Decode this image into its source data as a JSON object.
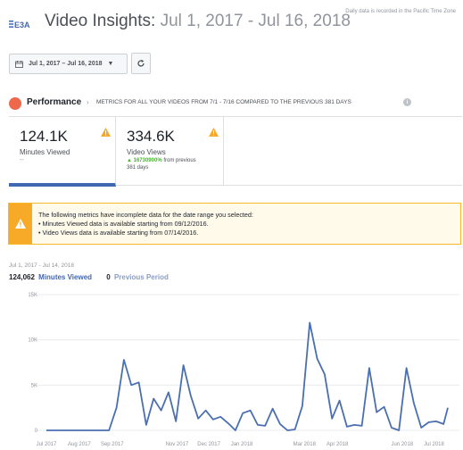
{
  "header": {
    "timezone_note": "Daily data is recorded in the Pacific Time Zone",
    "logo_text": "E3A",
    "title": "Video Insights:",
    "title_range": "Jul 1, 2017 - Jul 16, 2018"
  },
  "toolbar": {
    "date_range_label": "Jul 1, 2017 – Jul 16, 2018"
  },
  "performance": {
    "title": "Performance",
    "description": "METRICS FOR ALL YOUR VIDEOS FROM 7/1 - 7/16 COMPARED TO THE PREVIOUS 381 DAYS"
  },
  "metrics": [
    {
      "value": "124.1K",
      "label": "Minutes Viewed",
      "sub": "--"
    },
    {
      "value": "334.6K",
      "label": "Video Views",
      "change": "16730900%",
      "change_suffix": "from previous",
      "change_days": "381 days"
    }
  ],
  "alert": {
    "line1": "The following metrics have incomplete data for the date range you selected:",
    "line2": "• Minutes Viewed data is available starting from 09/12/2016.",
    "line3": "• Video Views data is available starting from 07/14/2016."
  },
  "chart_header": {
    "range": "Jul 1, 2017 - Jul 14, 2018",
    "series1_value": "124,062",
    "series1_name": "Minutes Viewed",
    "series2_value": "0",
    "series2_name": "Previous Period"
  },
  "colors": {
    "accent": "#4267b2",
    "line": "#4a6fb0",
    "warning": "#f7a928"
  },
  "chart_data": {
    "type": "line",
    "xlabels": [
      "Jul 2017",
      "Aug 2017",
      "Sep 2017",
      "Nov 2017",
      "Dec 2017",
      "Jan 2018",
      "Mar 2018",
      "Apr 2018",
      "Jun 2018",
      "Jul 2018"
    ],
    "ylabels": [
      "15K",
      "10K",
      "5K",
      "0"
    ],
    "ylim": [
      0,
      15000
    ],
    "grid": true,
    "series": [
      {
        "name": "Minutes Viewed",
        "x": [
          "2017-07-01",
          "2017-07-15",
          "2017-08-01",
          "2017-08-15",
          "2017-08-29",
          "2017-09-05",
          "2017-09-12",
          "2017-09-19",
          "2017-09-26",
          "2017-10-03",
          "2017-10-10",
          "2017-10-17",
          "2017-10-24",
          "2017-10-31",
          "2017-11-07",
          "2017-11-14",
          "2017-11-21",
          "2017-11-28",
          "2017-12-05",
          "2017-12-12",
          "2017-12-19",
          "2017-12-26",
          "2018-01-02",
          "2018-01-09",
          "2018-01-16",
          "2018-01-23",
          "2018-01-30",
          "2018-02-06",
          "2018-02-13",
          "2018-02-20",
          "2018-02-27",
          "2018-03-06",
          "2018-03-13",
          "2018-03-20",
          "2018-03-27",
          "2018-04-03",
          "2018-04-10",
          "2018-04-17",
          "2018-04-24",
          "2018-05-01",
          "2018-05-08",
          "2018-05-15",
          "2018-05-22",
          "2018-05-29",
          "2018-06-05",
          "2018-06-12",
          "2018-06-19",
          "2018-06-26",
          "2018-07-03",
          "2018-07-10",
          "2018-07-14"
        ],
        "y": [
          0,
          0,
          0,
          0,
          0,
          2500,
          7800,
          5000,
          5300,
          600,
          3500,
          2200,
          4200,
          1000,
          7200,
          3800,
          1300,
          2200,
          1200,
          1500,
          800,
          0,
          1900,
          2200,
          600,
          500,
          2400,
          700,
          0,
          100,
          2700,
          11900,
          7900,
          6200,
          1300,
          3300,
          400,
          600,
          500,
          6900,
          2000,
          2600,
          300,
          0,
          6900,
          3000,
          300,
          900,
          1000,
          700,
          2500
        ]
      }
    ]
  }
}
